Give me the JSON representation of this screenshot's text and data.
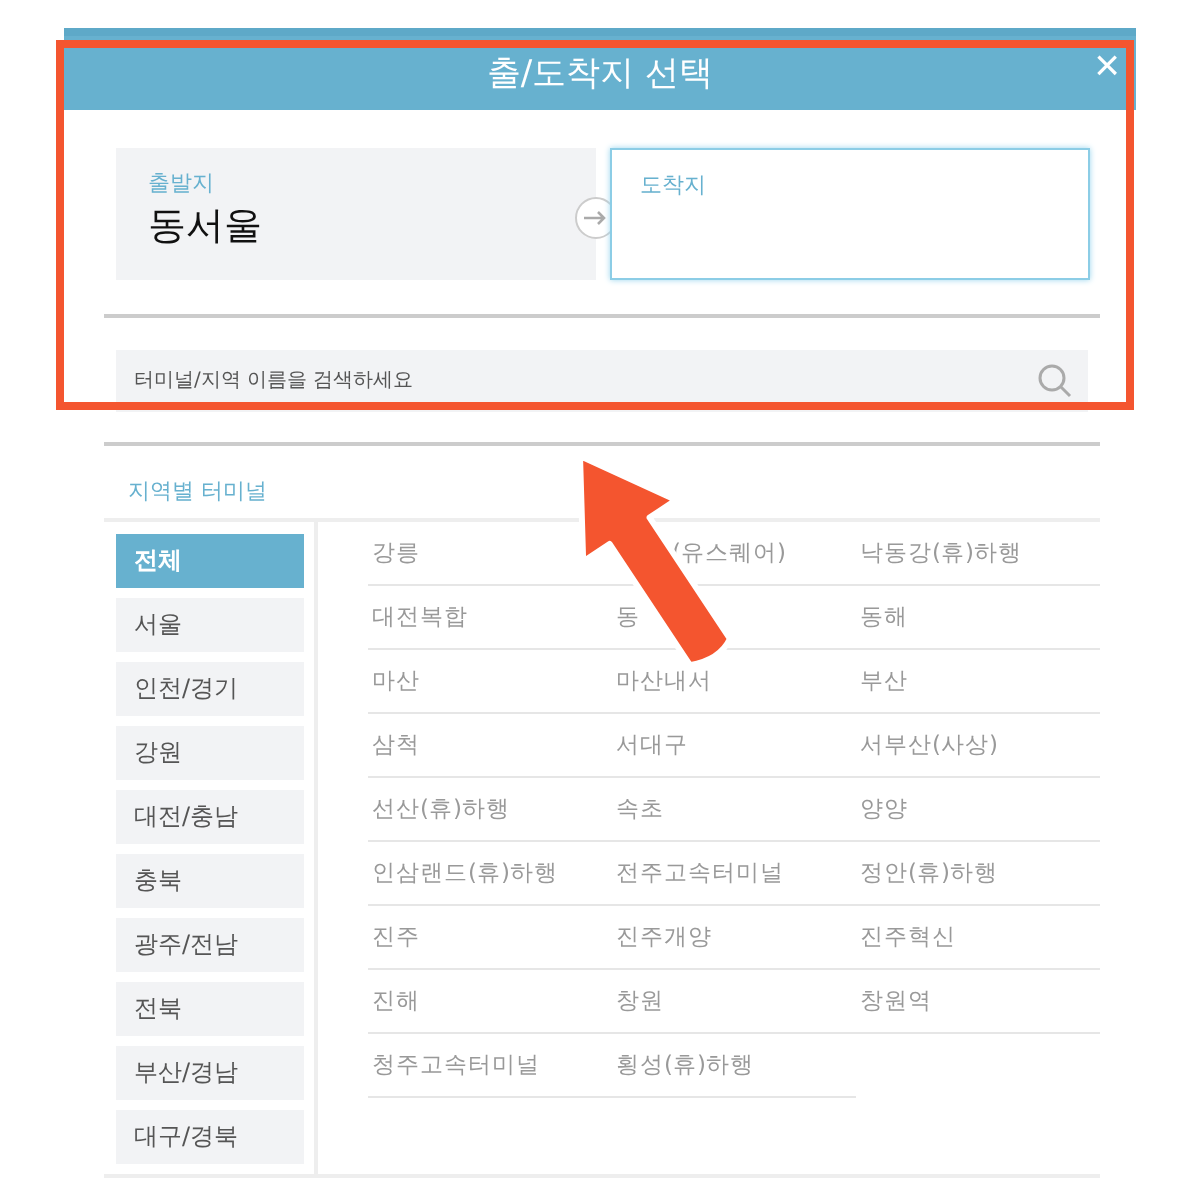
{
  "dialog": {
    "title": "출/도착지 선택",
    "close": "×"
  },
  "departure": {
    "label": "출발지",
    "value": "동서울"
  },
  "arrival": {
    "label": "도착지",
    "focused": true
  },
  "search": {
    "placeholder": "터미널/지역 이름을 검색하세요"
  },
  "section_title": "지역별 터미널",
  "regions": [
    {
      "label": "전체",
      "selected": true
    },
    {
      "label": "서울",
      "selected": false
    },
    {
      "label": "인천/경기",
      "selected": false
    },
    {
      "label": "강원",
      "selected": false
    },
    {
      "label": "대전/충남",
      "selected": false
    },
    {
      "label": "충북",
      "selected": false
    },
    {
      "label": "광주/전남",
      "selected": false
    },
    {
      "label": "전북",
      "selected": false
    },
    {
      "label": "부산/경남",
      "selected": false
    },
    {
      "label": "대구/경북",
      "selected": false
    }
  ],
  "terminals": [
    {
      "name": "강릉",
      "kind": "full"
    },
    {
      "name": "(유스퀘어)",
      "kind": "covered"
    },
    {
      "name": "낙동강(휴)하행",
      "kind": "full"
    },
    {
      "name": "대전복합",
      "kind": "full"
    },
    {
      "name": "동",
      "kind": "full"
    },
    {
      "name": "동해",
      "kind": "full"
    },
    {
      "name": "마산",
      "kind": "full"
    },
    {
      "name": "마산내서",
      "kind": "full"
    },
    {
      "name": "부산",
      "kind": "full"
    },
    {
      "name": "삼척",
      "kind": "full"
    },
    {
      "name": "서대구",
      "kind": "full"
    },
    {
      "name": "서부산(사상)",
      "kind": "full"
    },
    {
      "name": "선산(휴)하행",
      "kind": "full"
    },
    {
      "name": "속초",
      "kind": "full"
    },
    {
      "name": "양양",
      "kind": "full"
    },
    {
      "name": "인삼랜드(휴)하행",
      "kind": "full"
    },
    {
      "name": "전주고속터미널",
      "kind": "full"
    },
    {
      "name": "정안(휴)하행",
      "kind": "full"
    },
    {
      "name": "진주",
      "kind": "full"
    },
    {
      "name": "진주개양",
      "kind": "full"
    },
    {
      "name": "진주혁신",
      "kind": "full"
    },
    {
      "name": "진해",
      "kind": "full"
    },
    {
      "name": "창원",
      "kind": "full"
    },
    {
      "name": "창원역",
      "kind": "full"
    },
    {
      "name": "청주고속터미널",
      "kind": "full"
    },
    {
      "name": "횡성(휴)하행",
      "kind": "full"
    }
  ],
  "annotations": {
    "highlight_frame": true,
    "pointer_arrow": true
  }
}
